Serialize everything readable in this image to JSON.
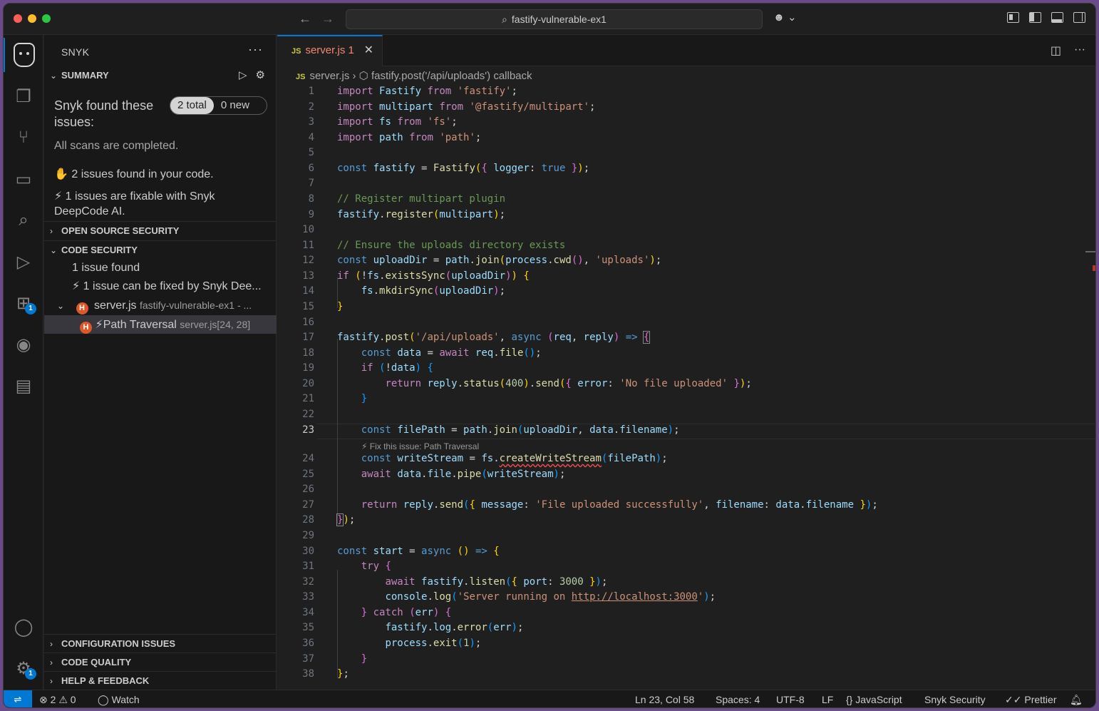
{
  "titlebar": {
    "search_text": "fastify-vulnerable-ex1"
  },
  "activity": {
    "extensions_badge": "1",
    "settings_badge": "1"
  },
  "sidebar": {
    "title": "SNYK",
    "summary": {
      "header": "SUMMARY",
      "found_title": "Snyk found these issues:",
      "pill_total": "2 total",
      "pill_new": "0 new",
      "scans_done": "All scans are completed.",
      "issues_line": "✋ 2 issues found in your code.",
      "fixable_line": "⚡ 1 issues are fixable with Snyk DeepCode AI."
    },
    "oss_header": "OPEN SOURCE SECURITY",
    "code_security": {
      "header": "CODE SECURITY",
      "issue_found": "1 issue found",
      "fixable": "⚡ 1 issue can be fixed by Snyk Dee...",
      "file_name": "server.js",
      "file_desc": "fastify-vulnerable-ex1 - ...",
      "issue_title": "⚡Path Traversal",
      "issue_loc": "server.js[24, 28]",
      "severity_letter": "H"
    },
    "config_header": "CONFIGURATION ISSUES",
    "quality_header": "CODE QUALITY",
    "help_header": "HELP & FEEDBACK"
  },
  "editor": {
    "tab": {
      "file": "server.js",
      "problems": "1",
      "lang_tag": "JS"
    },
    "breadcrumb": {
      "file": "server.js",
      "symbol": "fastify.post('/api/uploads') callback"
    },
    "codelens": "⚡ Fix this issue: Path Traversal",
    "line_numbers": [
      "1",
      "2",
      "3",
      "4",
      "5",
      "6",
      "7",
      "8",
      "9",
      "10",
      "11",
      "12",
      "13",
      "14",
      "15",
      "16",
      "17",
      "18",
      "19",
      "20",
      "21",
      "22",
      "23",
      "24",
      "25",
      "26",
      "27",
      "28",
      "29",
      "30",
      "31",
      "32",
      "33",
      "34",
      "35",
      "36",
      "37",
      "38"
    ],
    "current_line": "23"
  },
  "statusbar": {
    "errors": "2",
    "warnings": "0",
    "watch": "Watch",
    "position": "Ln 23, Col 58",
    "spaces": "Spaces: 4",
    "encoding": "UTF-8",
    "eol": "LF",
    "language": "JavaScript",
    "snyk": "Snyk Security",
    "prettier": "Prettier"
  },
  "colors": {
    "accent": "#0078d4",
    "severity_high": "#e0562b",
    "error_tab": "#f48771"
  }
}
